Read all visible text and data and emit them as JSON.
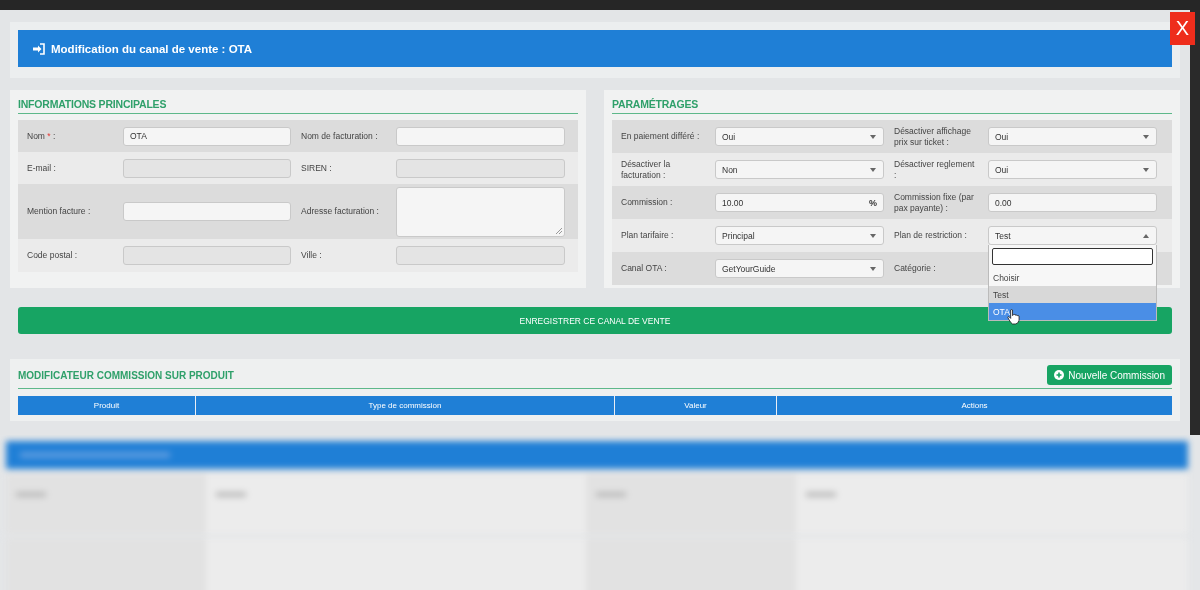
{
  "dialog": {
    "title": "Modification du canal de vente : OTA",
    "close_label": "X"
  },
  "main_info": {
    "title": "INFORMATIONS PRINCIPALES",
    "rows": [
      [
        {
          "label": "Nom ",
          "required_mark": "*",
          "label_end": " :",
          "field": {
            "kind": "text",
            "value": "OTA",
            "disabled": false
          }
        },
        {
          "label": "Nom de facturation :",
          "field": {
            "kind": "text",
            "disabled": false
          }
        }
      ],
      [
        {
          "label": "E-mail :",
          "field": {
            "kind": "text",
            "disabled": true
          }
        },
        {
          "label": "SIREN :",
          "field": {
            "kind": "text",
            "disabled": true
          }
        }
      ],
      [
        {
          "label": "Mention facture :",
          "field": {
            "kind": "text",
            "disabled": false
          }
        },
        {
          "label": "Adresse facturation :",
          "field": {
            "kind": "textarea",
            "disabled": false
          }
        }
      ],
      [
        {
          "label": "Code postal :",
          "field": {
            "kind": "text",
            "disabled": true
          }
        },
        {
          "label": "Ville :",
          "field": {
            "kind": "text",
            "disabled": true
          }
        }
      ]
    ]
  },
  "settings": {
    "title": "PARAMÉTRAGES",
    "rows": [
      [
        {
          "label": "En paiement différé :",
          "field": {
            "kind": "select",
            "value": "Oui",
            "open": false
          }
        },
        {
          "label": "Désactiver affichage prix sur ticket :",
          "field": {
            "kind": "select",
            "value": "Oui",
            "open": false
          }
        }
      ],
      [
        {
          "label": "Désactiver la facturation :",
          "field": {
            "kind": "select",
            "value": "Non",
            "open": false
          }
        },
        {
          "label": "Désactiver reglement :",
          "field": {
            "kind": "select",
            "value": "Oui",
            "open": false
          }
        }
      ],
      [
        {
          "label": "Commission :",
          "field": {
            "kind": "number",
            "value": "10.00",
            "unit": "%"
          }
        },
        {
          "label": "Commission fixe (par pax payante) :",
          "field": {
            "kind": "number",
            "value": "0.00"
          }
        }
      ],
      [
        {
          "label": "Plan tarifaire :",
          "field": {
            "kind": "select",
            "value": "Principal",
            "open": false
          }
        },
        {
          "label": "Plan de restriction :",
          "field": {
            "kind": "select",
            "value": "Test",
            "open": true
          }
        }
      ],
      [
        {
          "label": "Canal OTA :",
          "field": {
            "kind": "select",
            "value": "GetYourGuide",
            "open": false
          }
        },
        {
          "label": "Catégorie :"
        }
      ]
    ],
    "dropdown_options": [
      {
        "label": "Choisir",
        "selected": false,
        "highlighted": false
      },
      {
        "label": "Test",
        "selected": true,
        "highlighted": false
      },
      {
        "label": "OTA",
        "selected": false,
        "highlighted": true
      }
    ]
  },
  "save_button": "ENREGISTRER CE CANAL DE VENTE",
  "commissions": {
    "title": "MODIFICATEUR COMMISSION SUR PRODUIT",
    "add_button": "Nouvelle Commission",
    "columns": [
      "Produit",
      "Type de commission",
      "Valeur",
      "Actions"
    ]
  }
}
